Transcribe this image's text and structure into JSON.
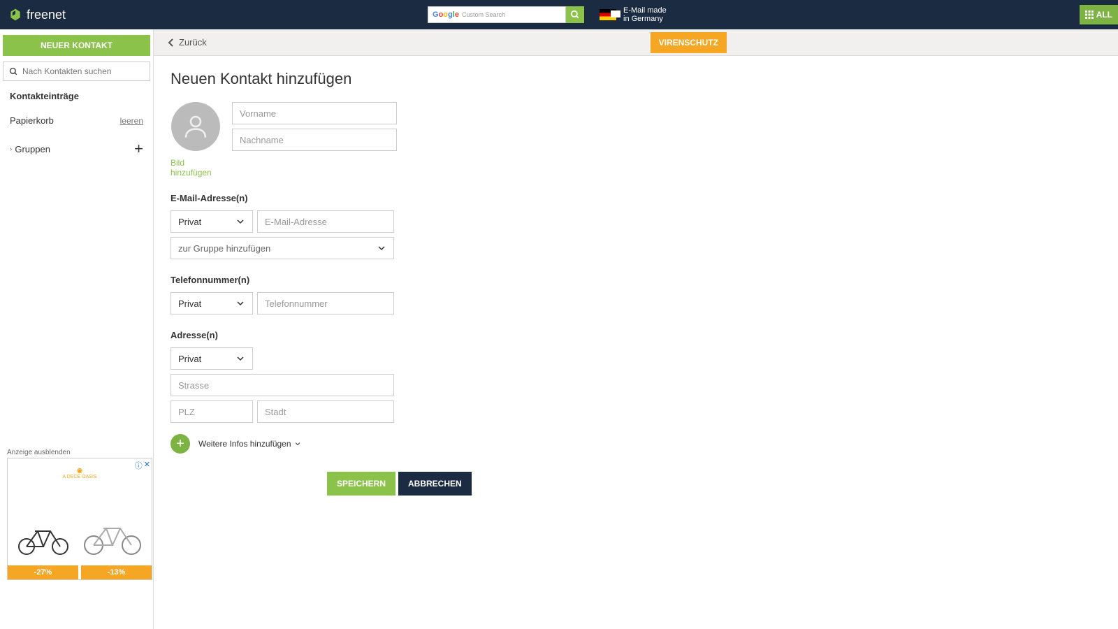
{
  "header": {
    "brand": "freenet",
    "search_placeholder": "Custom Search",
    "email_made": "E-Mail made",
    "in_germany": "in Germany",
    "all_label": "ALL"
  },
  "sidebar": {
    "new_contact": "NEUER KONTAKT",
    "search_placeholder": "Nach Kontakten suchen",
    "entries": "Kontakteinträge",
    "trash": "Papierkorb",
    "empty_link": "leeren",
    "groups": "Gruppen",
    "ad": {
      "hide_label": "Anzeige ausblenden",
      "brand": "A DECE OASIS",
      "price1": "-27%",
      "price2": "-13%"
    }
  },
  "topbar": {
    "back": "Zurück",
    "virenschutz": "VIRENSCHUTZ"
  },
  "form": {
    "title": "Neuen Kontakt hinzufügen",
    "add_image": "Bild hinzufügen",
    "firstname_ph": "Vorname",
    "lastname_ph": "Nachname",
    "email_section": "E-Mail-Adresse(n)",
    "email_type": "Privat",
    "email_ph": "E-Mail-Adresse",
    "add_to_group": "zur Gruppe hinzufügen",
    "phone_section": "Telefonnummer(n)",
    "phone_type": "Privat",
    "phone_ph": "Telefonnummer",
    "address_section": "Adresse(n)",
    "address_type": "Privat",
    "street_ph": "Strasse",
    "plz_ph": "PLZ",
    "city_ph": "Stadt",
    "more_info": "Weitere Infos hinzufügen",
    "save": "SPEICHERN",
    "cancel": "ABBRECHEN"
  }
}
